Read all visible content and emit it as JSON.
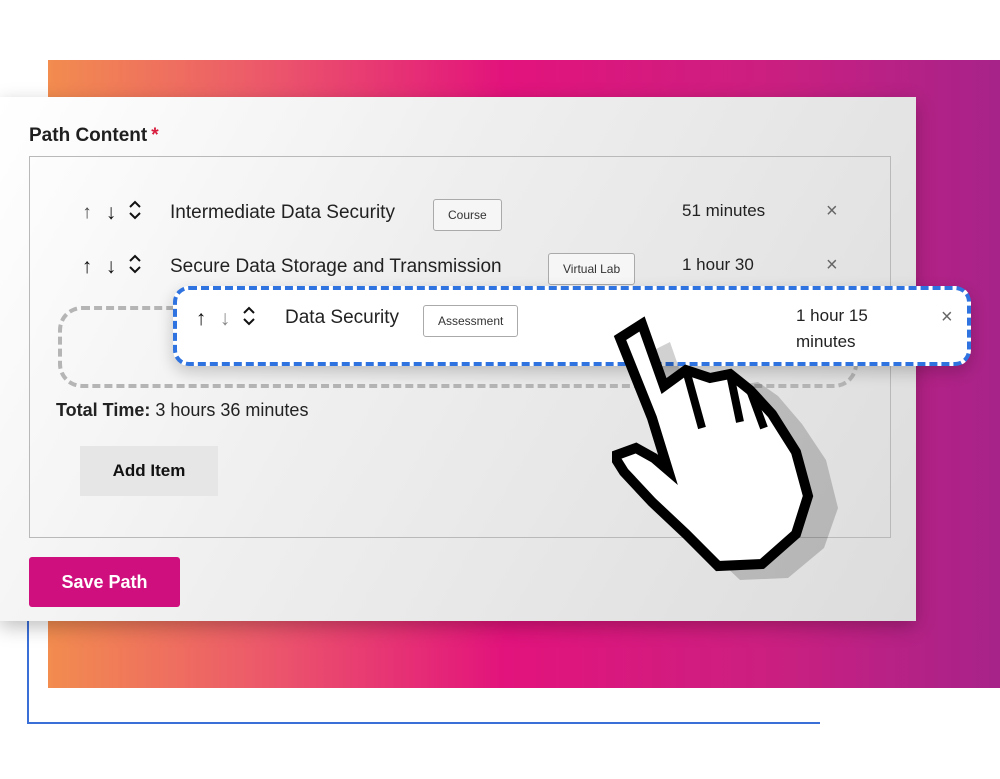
{
  "section": {
    "title": "Path Content",
    "required_mark": "*"
  },
  "items": [
    {
      "title": "Intermediate Data Security",
      "type": "Course",
      "duration": "51 minutes",
      "remove": "×"
    },
    {
      "title": "Secure Data Storage and Transmission",
      "type": "Virtual Lab",
      "duration": "1 hour 30",
      "remove": "×"
    }
  ],
  "dragging_item": {
    "title": "Data Security",
    "type": "Assessment",
    "duration_line1": "1 hour 15",
    "duration_line2": "minutes",
    "remove": "×"
  },
  "controls": {
    "up": "↑",
    "down": "↓",
    "move": "⌃⌄"
  },
  "total": {
    "label": "Total Time:",
    "value": "3 hours 36 minutes"
  },
  "buttons": {
    "add_item": "Add Item",
    "save_path": "Save Path"
  },
  "icons": [
    "arrow-up-icon",
    "arrow-down-icon",
    "move-handle-icon",
    "close-icon",
    "hand-pointer-cursor-icon"
  ],
  "colors": {
    "primary": "#cf0f7d",
    "drag_border": "#2f73e0",
    "required": "#d81b3d"
  }
}
